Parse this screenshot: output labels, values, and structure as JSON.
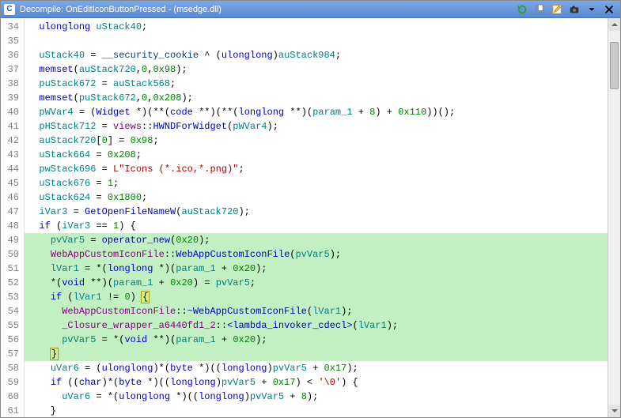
{
  "titlebar": {
    "app_icon_text": "C",
    "title": "Decompile: OnEditIconButtonPressed - (msedge.dll)"
  },
  "toolbar_icons": {
    "refresh": "refresh-icon",
    "copy": "copy-icon",
    "edit": "edit-icon",
    "snapshot": "snapshot-icon",
    "menu": "menu-icon",
    "close": "close-icon"
  },
  "gutter_start": 34,
  "code_lines": [
    {
      "n": 34,
      "hl": false,
      "html": "  <span class='k'>ulonglong</span> <span class='ty'>uStack40</span>;"
    },
    {
      "n": 35,
      "hl": false,
      "html": "  "
    },
    {
      "n": 36,
      "hl": false,
      "html": "  <span class='ty'>uStack40</span> = <span class='gl'>__security_cookie</span> ^ (<span class='k'>ulonglong</span>)<span class='ty'>auStack984</span>;"
    },
    {
      "n": 37,
      "hl": false,
      "html": "  <span class='id'>memset</span>(<span class='ty'>auStack720</span>,<span class='nm'>0</span>,<span class='nm'>0x98</span>);"
    },
    {
      "n": 38,
      "hl": false,
      "html": "  <span class='ty'>puStack672</span> = <span class='ty'>auStack568</span>;"
    },
    {
      "n": 39,
      "hl": false,
      "html": "  <span class='id'>memset</span>(<span class='ty'>puStack672</span>,<span class='nm'>0</span>,<span class='nm'>0x208</span>);"
    },
    {
      "n": 40,
      "hl": false,
      "html": "  <span class='ty'>pWVar4</span> = (<span class='id'>Widget</span> *)(**(<span class='k'>code</span> **)(**(<span class='k'>longlong</span> **)(<span class='ty'>param_1</span> + <span class='nm'>8</span>) + <span class='nm'>0x110</span>))();"
    },
    {
      "n": 41,
      "hl": false,
      "html": "  <span class='ty'>pHStack712</span> = <span class='pp'>views</span>::<span class='id'>HWNDForWidget</span>(<span class='ty'>pWVar4</span>);"
    },
    {
      "n": 42,
      "hl": false,
      "html": "  <span class='ty'>auStack720</span>[<span class='nm'>0</span>] = <span class='nm'>0x98</span>;"
    },
    {
      "n": 43,
      "hl": false,
      "html": "  <span class='ty'>uStack664</span> = <span class='nm'>0x208</span>;"
    },
    {
      "n": 44,
      "hl": false,
      "html": "  <span class='ty'>pwStack696</span> = <span class='st'>L\"Icons (*.ico,*.png)\"</span>;"
    },
    {
      "n": 45,
      "hl": false,
      "html": "  <span class='ty'>uStack676</span> = <span class='nm'>1</span>;"
    },
    {
      "n": 46,
      "hl": false,
      "html": "  <span class='ty'>uStack624</span> = <span class='nm'>0x1800</span>;"
    },
    {
      "n": 47,
      "hl": false,
      "html": "  <span class='ty'>iVar3</span> = <span class='id'>GetOpenFileNameW</span>(<span class='ty'>auStack720</span>);"
    },
    {
      "n": 48,
      "hl": false,
      "html": "  <span class='k'>if</span> (<span class='ty'>iVar3</span> == <span class='nm'>1</span>) {"
    },
    {
      "n": 49,
      "hl": true,
      "html": "    <span class='ty'>pvVar5</span> = <span class='id'>operator_new</span>(<span class='nm'>0x20</span>);"
    },
    {
      "n": 50,
      "hl": true,
      "html": "    <span class='pp'>WebAppCustomIconFile</span>::<span class='id'>WebAppCustomIconFile</span>(<span class='ty'>pvVar5</span>);"
    },
    {
      "n": 51,
      "hl": true,
      "html": "    <span class='ty'>lVar1</span> = *(<span class='k'>longlong</span> *)(<span class='ty'>param_1</span> + <span class='nm'>0x20</span>);"
    },
    {
      "n": 52,
      "hl": true,
      "html": "    *(<span class='k'>void</span> **)(<span class='ty'>param_1</span> + <span class='nm'>0x20</span>) = <span class='ty'>pvVar5</span>;"
    },
    {
      "n": 53,
      "hl": true,
      "html": "    <span class='k'>if</span> (<span class='ty'>lVar1</span> != <span class='nm'>0</span>) <span class='cursorbox'>{</span>"
    },
    {
      "n": 54,
      "hl": true,
      "html": "      <span class='pp'>WebAppCustomIconFile</span>::<span class='id'>~WebAppCustomIconFile</span>(<span class='ty'>lVar1</span>);"
    },
    {
      "n": 55,
      "hl": true,
      "html": "      <span class='pp'>_Closure_wrapper_a6440fd1_2</span>::<span class='id'>&lt;lambda_invoker_cdecl&gt;</span>(<span class='ty'>lVar1</span>);"
    },
    {
      "n": 56,
      "hl": true,
      "html": "      <span class='ty'>pvVar5</span> = *(<span class='k'>void</span> **)(<span class='ty'>param_1</span> + <span class='nm'>0x20</span>);"
    },
    {
      "n": 57,
      "hl": true,
      "html": "    <span class='cursorbox'>}</span>"
    },
    {
      "n": 58,
      "hl": false,
      "html": "    <span class='ty'>uVar6</span> = (<span class='k'>ulonglong</span>)*(<span class='k'>byte</span> *)((<span class='k'>longlong</span>)<span class='ty'>pvVar5</span> + <span class='nm'>0x17</span>);"
    },
    {
      "n": 59,
      "hl": false,
      "html": "    <span class='k'>if</span> ((<span class='k'>char</span>)*(<span class='k'>byte</span> *)((<span class='k'>longlong</span>)<span class='ty'>pvVar5</span> + <span class='nm'>0x17</span>) &lt; <span class='st'>'\\0'</span>) {"
    },
    {
      "n": 60,
      "hl": false,
      "html": "      <span class='ty'>uVar6</span> = *(<span class='k'>ulonglong</span> *)((<span class='k'>longlong</span>)<span class='ty'>pvVar5</span> + <span class='nm'>8</span>);"
    },
    {
      "n": 61,
      "hl": false,
      "html": "    }"
    }
  ]
}
